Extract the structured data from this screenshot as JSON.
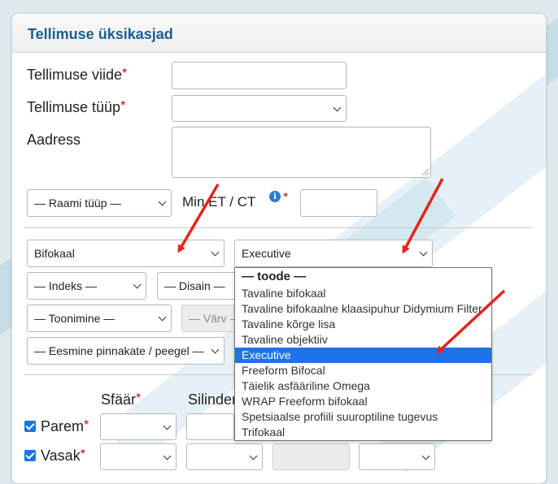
{
  "card": {
    "title": "Tellimuse üksikasjad"
  },
  "form": {
    "order_ref_label": "Tellimuse viide",
    "order_type_label": "Tellimuse tüüp",
    "address_label": "Aadress",
    "required_mark": "*",
    "frame_type": "— Raami tüüp —",
    "min_et_ct_label": "Min ET / CT",
    "lens_type": "Bifokaal",
    "product": "Executive",
    "index": "— Indeks —",
    "design": "— Disain —",
    "tinting": "— Toonimine —",
    "color": "— Värv —",
    "coating": "— Eesmine pinnakate / peegel —"
  },
  "rx": {
    "sphere_header": "Sfäär",
    "cylinder_header": "Silinder",
    "right_label": "Parem",
    "left_label": "Vasak"
  },
  "dropdown": {
    "group_label": "— toode —",
    "options": [
      "Tavaline bifokaal",
      "Tavaline bifokaalne klaasipuhur Didymium Filter",
      "Tavaline kõrge lisa",
      "Tavaline objektiiv",
      "Executive",
      "Freeform Bifocal",
      "Täielik asfääriline Omega",
      "WRAP Freeform bifokaal",
      "Spetsiaalse profiili suuroptiline tugevus",
      "Trifokaal"
    ],
    "selected": "Executive"
  },
  "colors": {
    "title": "#1b5e8c",
    "required": "#d00000",
    "selection": "#1e73e8",
    "arrow": "#e8231a",
    "checkbox": "#1a73e8"
  },
  "icons": [
    "info-icon",
    "chevron-down-icon",
    "checkbox-checked-icon",
    "arrow-annotation-icon"
  ]
}
